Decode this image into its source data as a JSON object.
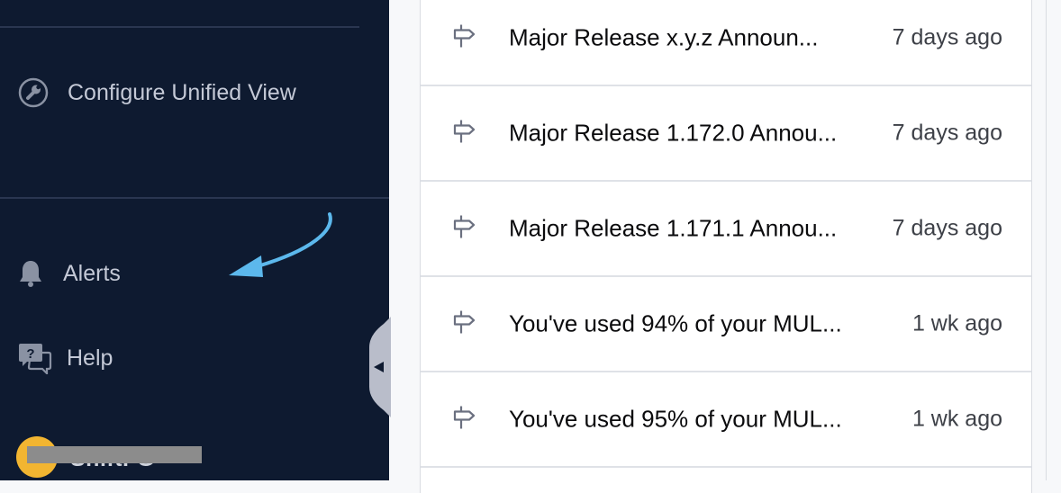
{
  "sidebar": {
    "configure_label": "Configure Unified View",
    "alerts_label": "Alerts",
    "help_label": "Help",
    "user_label": "ShiftFG"
  },
  "notifications": [
    {
      "title": "Major Release x.y.z Announ...",
      "time": "7 days ago"
    },
    {
      "title": "Major Release 1.172.0 Annou...",
      "time": "7 days ago"
    },
    {
      "title": "Major Release 1.171.1 Annou...",
      "time": "7 days ago"
    },
    {
      "title": "You've used 94% of your MUL...",
      "time": "1 wk ago"
    },
    {
      "title": "You've used 95% of your MUL...",
      "time": "1 wk ago"
    }
  ]
}
